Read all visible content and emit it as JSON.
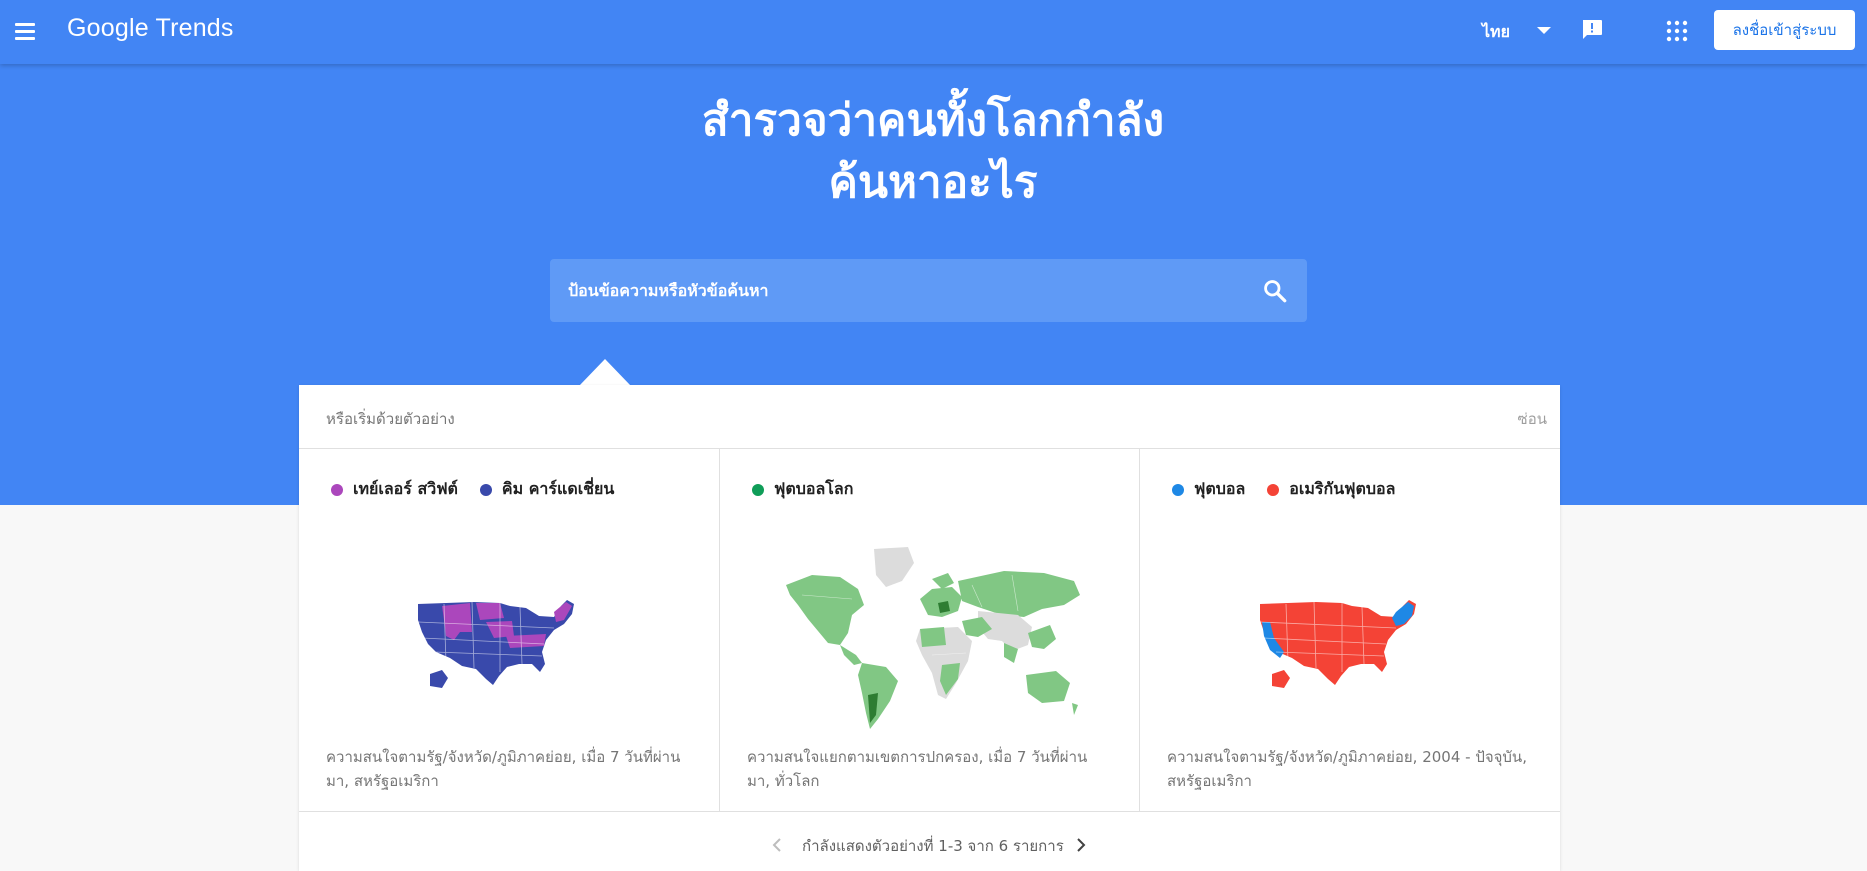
{
  "header": {
    "logo": {
      "brand": "Google",
      "product": "Trends"
    },
    "language": "ไทย",
    "signin_label": "ลงชื่อเข้าสู่ระบบ",
    "icons": [
      "menu-icon",
      "dropdown-caret-icon",
      "feedback-icon",
      "apps-grid-icon"
    ]
  },
  "hero": {
    "title_line1": "สำรวจว่าคนทั้งโลกกำลัง",
    "title_line2": "ค้นหาอะไร",
    "search_placeholder": "ป้อนข้อความหรือหัวข้อค้นหา"
  },
  "examples": {
    "header_label": "หรือเริ่มด้วยตัวอย่าง",
    "hide_label": "ซ่อน",
    "cards": [
      {
        "legend": [
          {
            "label": "เทย์เลอร์ สวิฟต์",
            "color": "#ab47bc"
          },
          {
            "label": "คิม คาร์แดเชี่ยน",
            "color": "#3949ab"
          }
        ],
        "map": "usa",
        "caption": "ความสนใจตามรัฐ/จังหวัด/ภูมิภาคย่อย, เมื่อ 7 วันที่ผ่านมา, สหรัฐอเมริกา"
      },
      {
        "legend": [
          {
            "label": "ฟุตบอลโลก",
            "color": "#0f9d58"
          }
        ],
        "map": "world",
        "caption": "ความสนใจแยกตามเขตการปกครอง, เมื่อ 7 วันที่ผ่านมา, ทั่วโลก"
      },
      {
        "legend": [
          {
            "label": "ฟุตบอล",
            "color": "#1e88e5"
          },
          {
            "label": "อเมริกันฟุตบอล",
            "color": "#f44336"
          }
        ],
        "map": "usa",
        "caption": "ความสนใจตามรัฐ/จังหวัด/ภูมิภาคย่อย, 2004 - ปัจจุบัน, สหรัฐอเมริกา"
      }
    ],
    "pager_text": "กำลังแสดงตัวอย่างที่ 1-3 จาก 6 รายการ"
  },
  "colors": {
    "brand_blue": "#4285f4",
    "search_bg": "#5f9af6",
    "signin_text": "#1a73e8",
    "map_gray": "#dcdcdc",
    "map_green": "#81c784",
    "map_dark_green": "#2e7d32"
  }
}
